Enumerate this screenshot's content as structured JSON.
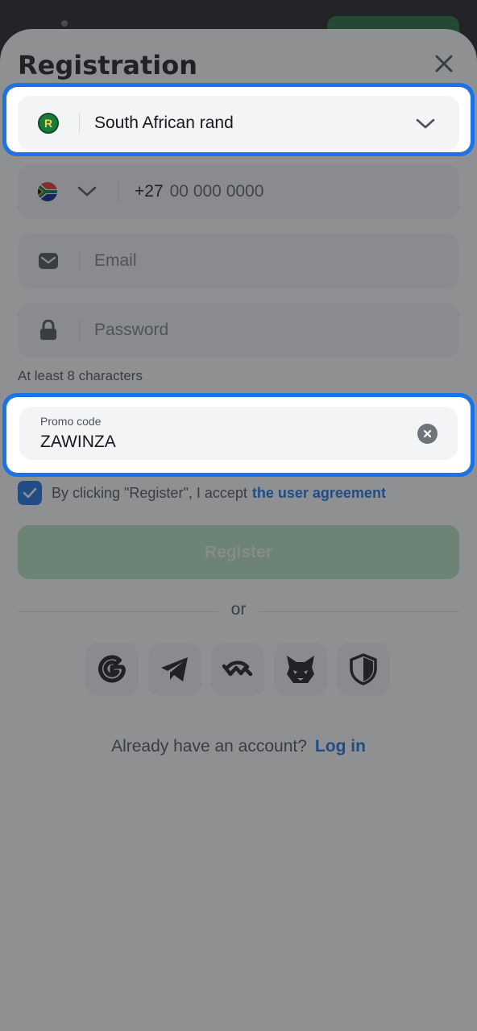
{
  "header": {
    "title": "Registration"
  },
  "currency": {
    "badge": "R",
    "value": "South African rand",
    "icon": "rand-badge-icon"
  },
  "phone": {
    "prefix": "+27",
    "placeholder": "00 000 0000",
    "flag_icon": "south-africa-flag-icon"
  },
  "email": {
    "placeholder": "Email",
    "icon": "mail-icon"
  },
  "password": {
    "placeholder": "Password",
    "icon": "lock-icon",
    "hint": "At least 8 characters"
  },
  "promo": {
    "label": "Promo code",
    "value": "ZAWINZA"
  },
  "agreement": {
    "checked": true,
    "text": "By clicking \"Register\", I accept",
    "link": "the user agreement"
  },
  "register": {
    "label": "Register"
  },
  "divider": {
    "text": "or"
  },
  "socials": [
    "google-icon",
    "telegram-icon",
    "walletconnect-icon",
    "metamask-fox-icon",
    "shield-icon"
  ],
  "footer": {
    "question": "Already have an account?",
    "login": "Log in"
  },
  "colors": {
    "accent": "#1a73e8",
    "register_disabled": "#b6e3c2",
    "overlay": "#282a2e"
  }
}
